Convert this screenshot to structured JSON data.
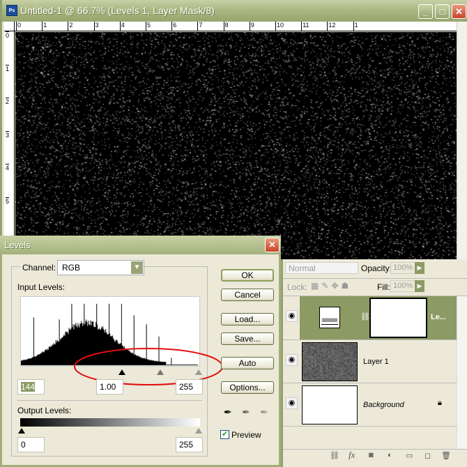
{
  "document": {
    "title": "Untitled-1 @ 66.7% (Levels 1, Layer Mask/8)",
    "app_icon": "Ps",
    "hruler": [
      "0",
      "1",
      "2",
      "3",
      "4",
      "5",
      "6",
      "7",
      "8",
      "9",
      "10",
      "11",
      "12",
      "1"
    ],
    "vruler": [
      "0",
      "1",
      "2",
      "3",
      "4",
      "5"
    ]
  },
  "levels": {
    "title": "Levels",
    "channel_label": "Channel:",
    "channel_value": "RGB",
    "input_label": "Input Levels:",
    "input_black": "144",
    "input_gamma": "1.00",
    "input_white": "255",
    "output_label": "Output Levels:",
    "output_black": "0",
    "output_white": "255",
    "buttons": {
      "ok": "OK",
      "cancel": "Cancel",
      "load": "Load...",
      "save": "Save...",
      "auto": "Auto",
      "options": "Options..."
    },
    "preview_label": "Preview",
    "preview_checked": true,
    "annotation_color": "#e01010"
  },
  "layers": {
    "blend_mode": "Normal",
    "opacity_label": "Opacity:",
    "opacity": "100%",
    "lock_label": "Lock:",
    "fill_label": "Fill:",
    "fill": "100%",
    "items": [
      {
        "name": "Le..."
      },
      {
        "name": "Layer 1"
      },
      {
        "name": "Background"
      }
    ],
    "selected_color": "#8c9a63"
  }
}
